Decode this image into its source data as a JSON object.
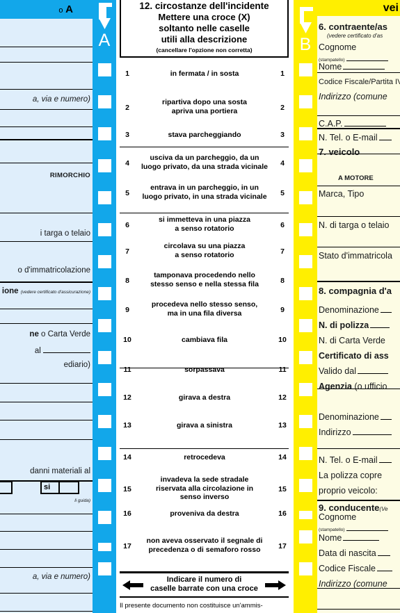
{
  "document": {
    "type": "constatazione-amichevole-incidente",
    "center_footnote": "Il presente documento non costituisce un'ammis-"
  },
  "vehicle_a": {
    "header_lead": "o",
    "header_letter": "A",
    "strip_letter": "A",
    "strip_color": "#12a7ea",
    "panel_color": "#dfeefb",
    "rows": [
      {
        "text": "a, via e numero)",
        "style": "italic"
      },
      {
        "text": "RIMORCHIO",
        "style": "caps"
      },
      {
        "text": "i targa o telaio",
        "style": "normal"
      },
      {
        "text": "o d'immatricolazione",
        "style": "normal"
      },
      {
        "text": "ione",
        "style": "bold",
        "note": "(vedere certificato d'assicurazione)"
      },
      {
        "text": "ne o Carta Verde",
        "style": "bold-lead",
        "lead": "ne"
      },
      {
        "text": "al",
        "style": "normal"
      },
      {
        "text": "ediario)",
        "style": "normal"
      },
      {
        "text": "danni materiali al",
        "style": "normal"
      },
      {
        "text": "li guida)",
        "style": "tiny-italic"
      },
      {
        "text": "a, via e numero)",
        "style": "italic"
      }
    ],
    "yes_label": "si",
    "checkbox_count": 17
  },
  "circumstances": {
    "section_number": "12.",
    "section_title": "circostanze dell'incidente",
    "instruction_line1": "Mettere una croce (X)",
    "instruction_line2": "soltanto nelle caselle",
    "instruction_line3": "utili  alla  descrizione",
    "instruction_note": "(cancellare l'opzione non corretta)",
    "items": [
      {
        "n": 1,
        "lines": [
          "in fermata / in sosta"
        ]
      },
      {
        "n": 2,
        "lines": [
          "ripartiva dopo una sosta",
          "apriva una portiera"
        ]
      },
      {
        "n": 3,
        "lines": [
          "stava parcheggiando"
        ]
      },
      {
        "n": 4,
        "lines": [
          "usciva da un parcheggio, da un",
          "luogo privato, da una strada vicinale"
        ]
      },
      {
        "n": 5,
        "lines": [
          "entrava in un parcheggio, in un",
          "luogo privato, in una strada vicinale"
        ]
      },
      {
        "n": 6,
        "lines": [
          "si immetteva in una piazza",
          "a senso rotatorio"
        ]
      },
      {
        "n": 7,
        "lines": [
          "circolava su una piazza",
          "a senso rotatorio"
        ]
      },
      {
        "n": 8,
        "lines": [
          "tamponava procedendo nello",
          "stesso senso e nella stessa fila"
        ]
      },
      {
        "n": 9,
        "lines": [
          "procedeva nello stesso senso,",
          "ma in una fila diversa"
        ]
      },
      {
        "n": 10,
        "lines": [
          "cambiava fila"
        ]
      },
      {
        "n": 11,
        "lines": [
          "sorpassava"
        ]
      },
      {
        "n": 12,
        "lines": [
          "girava a destra"
        ]
      },
      {
        "n": 13,
        "lines": [
          "girava a sinistra"
        ]
      },
      {
        "n": 14,
        "lines": [
          "retrocedeva"
        ]
      },
      {
        "n": 15,
        "lines": [
          "invadeva la sede stradale",
          "riservata alla circolazione in",
          "senso inverso"
        ]
      },
      {
        "n": 16,
        "lines": [
          "proveniva da destra"
        ]
      },
      {
        "n": 17,
        "lines": [
          "non aveva osservato il segnale di",
          "precedenza o di semaforo rosso"
        ]
      }
    ],
    "total_line1": "Indicare il numero di",
    "total_line2": "caselle barrate con una croce"
  },
  "vehicle_b": {
    "header_text": "vei",
    "strip_letter": "B",
    "strip_color": "#ffef00",
    "panel_color": "#fdfce4",
    "rows": [
      {
        "text": "6. contraente/as",
        "style": "section"
      },
      {
        "text": "(vedere certificato d'as",
        "style": "small-italic"
      },
      {
        "text": "Cognome",
        "style": "normal"
      },
      {
        "text": "(stampatello)",
        "style": "tiny"
      },
      {
        "text": "Nome",
        "style": "normal",
        "rule": true
      },
      {
        "text": "Codice Fiscale/Partita IVA",
        "style": "condensed"
      },
      {
        "text": "Indirizzo (comune",
        "style": "normal-italic"
      },
      {
        "text": "C.A.P.",
        "style": "normal",
        "rule": true
      },
      {
        "text": "N. Tel. o E-mail",
        "style": "normal",
        "rule": true
      },
      {
        "text": "7. veicolo",
        "style": "section"
      },
      {
        "text": "A MOTORE",
        "style": "caps"
      },
      {
        "text": "Marca, Tipo",
        "style": "normal"
      },
      {
        "text": "N. di targa o telaio",
        "style": "normal"
      },
      {
        "text": "Stato d'immatricola",
        "style": "normal"
      },
      {
        "text": "8. compagnia d'a",
        "style": "section"
      },
      {
        "text": "Denominazione",
        "style": "normal",
        "rule": true
      },
      {
        "text": "N. di polizza",
        "style": "bold",
        "rule": true
      },
      {
        "text": "N. di Carta Verde",
        "style": "normal"
      },
      {
        "text": "Certificato di ass",
        "style": "bold"
      },
      {
        "text": "Valido dal",
        "style": "normal",
        "rule": true
      },
      {
        "text": "Agenzia (o ufficio",
        "style": "bold-lead"
      },
      {
        "text": "Denominazione",
        "style": "normal",
        "rule": true
      },
      {
        "text": "Indirizzo",
        "style": "normal",
        "rule": true
      },
      {
        "text": "N. Tel. o E-mail",
        "style": "normal",
        "rule": true
      },
      {
        "text": "La polizza copre",
        "style": "normal"
      },
      {
        "text": "proprio veicolo:",
        "style": "normal"
      },
      {
        "text": "9. conducente",
        "style": "section",
        "note": "(Ve"
      },
      {
        "text": "Cognome",
        "style": "normal"
      },
      {
        "text": "(stampatello)",
        "style": "tiny"
      },
      {
        "text": "Nome",
        "style": "normal",
        "rule": true
      },
      {
        "text": "Data di nascita",
        "style": "normal",
        "rule": true
      },
      {
        "text": "Codice Fiscale",
        "style": "normal",
        "rule": true
      },
      {
        "text": "Indirizzo (comune",
        "style": "normal-italic"
      }
    ],
    "checkbox_count": 17
  }
}
